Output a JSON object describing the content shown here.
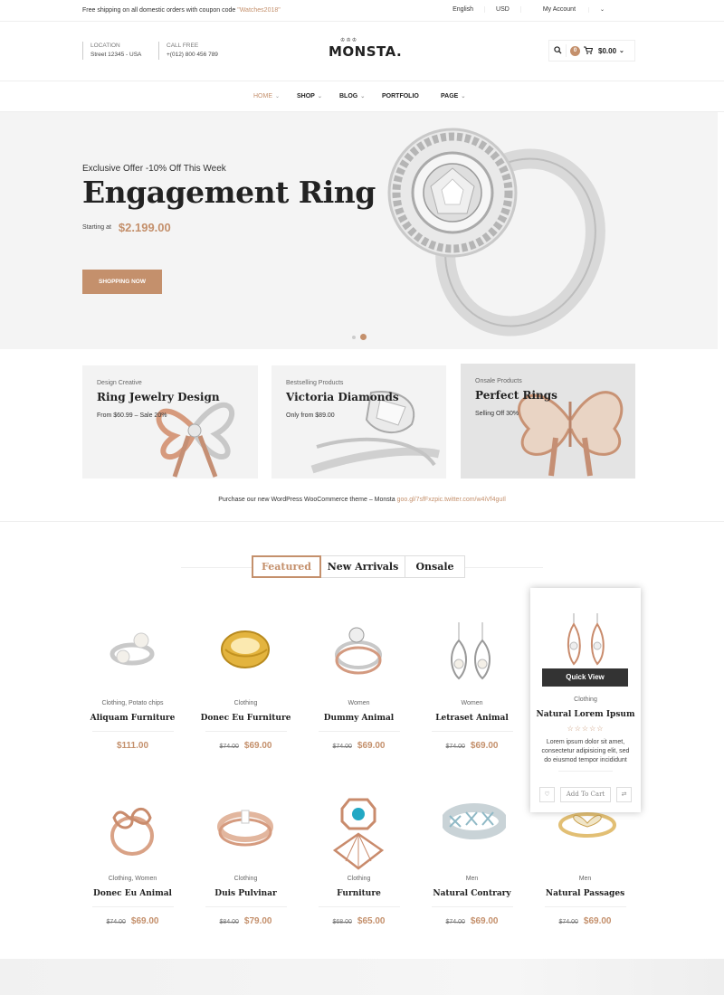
{
  "topbar": {
    "shipping_text": "Free shipping on all domestic orders with coupon code ",
    "coupon_code": "\"Watches2018\"",
    "language": "English",
    "currency": "USD",
    "account": "My Account"
  },
  "header": {
    "location_label": "LOCATION",
    "location_value": "Street 12345 - USA",
    "call_label": "CALL FREE",
    "call_value": "+(012) 800 456 789",
    "logo": "MONSTA.",
    "cart_count": "0",
    "cart_total": "$0.00"
  },
  "nav": {
    "items": [
      {
        "label": "HOME",
        "active": true
      },
      {
        "label": "SHOP"
      },
      {
        "label": "BLOG"
      },
      {
        "label": "PORTFOLIO"
      },
      {
        "label": "PAGE"
      }
    ]
  },
  "hero": {
    "offer": "Exclusive Offer -10% Off This Week",
    "title": "Engagement Ring",
    "starting_label": "Starting at",
    "price": "$2.199.00",
    "button": "SHOPPING NOW"
  },
  "promos": [
    {
      "small": "Design Creative",
      "title": "Ring Jewelry Design",
      "desc": "From $60.99 – Sale 20%"
    },
    {
      "small": "Bestselling Products",
      "title": "Victoria Diamonds",
      "desc": "Only from $89.00"
    },
    {
      "small": "Onsale Products",
      "title": "Perfect Rings",
      "desc": "Selling Off 30%"
    }
  ],
  "purchase": {
    "text": "Purchase our new WordPress WooCommerce theme – Monsta ",
    "link": "goo.gl/7sfFxzpic.twitter.com/w4iVf4guIl"
  },
  "tabs": [
    "Featured",
    "New Arrivals",
    "Onsale"
  ],
  "products": [
    {
      "cat": "Clothing, Potato chips",
      "name": "Aliquam Furniture",
      "old": "",
      "price": "$111.00"
    },
    {
      "cat": "Clothing",
      "name": "Donec Eu Furniture",
      "old": "$74.00",
      "price": "$69.00"
    },
    {
      "cat": "Women",
      "name": "Dummy Animal",
      "old": "$74.00",
      "price": "$69.00"
    },
    {
      "cat": "Women",
      "name": "Letraset Animal",
      "old": "$74.00",
      "price": "$69.00"
    },
    {
      "cat": "Clothing",
      "name": "Natural Lorem Ipsum",
      "old": "",
      "price": ""
    },
    {
      "cat": "Clothing, Women",
      "name": "Donec Eu Animal",
      "old": "$74.00",
      "price": "$69.00"
    },
    {
      "cat": "Clothing",
      "name": "Duis Pulvinar",
      "old": "$84.00",
      "price": "$79.00"
    },
    {
      "cat": "Clothing",
      "name": "Furniture",
      "old": "$68.00",
      "price": "$65.00"
    },
    {
      "cat": "Men",
      "name": "Natural Contrary",
      "old": "$74.00",
      "price": "$69.00"
    },
    {
      "cat": "Men",
      "name": "Natural Passages",
      "old": "$74.00",
      "price": "$69.00"
    }
  ],
  "hover_card": {
    "quick_view": "Quick View",
    "stars": "☆☆☆☆☆",
    "description": "Lorem ipsum dolor sit amet, consectetur adipisicing elit, sed do eiusmod tempor incididunt",
    "add_to_cart": "Add To Cart"
  },
  "colors": {
    "accent": "#c4906c",
    "dark": "#333333"
  }
}
